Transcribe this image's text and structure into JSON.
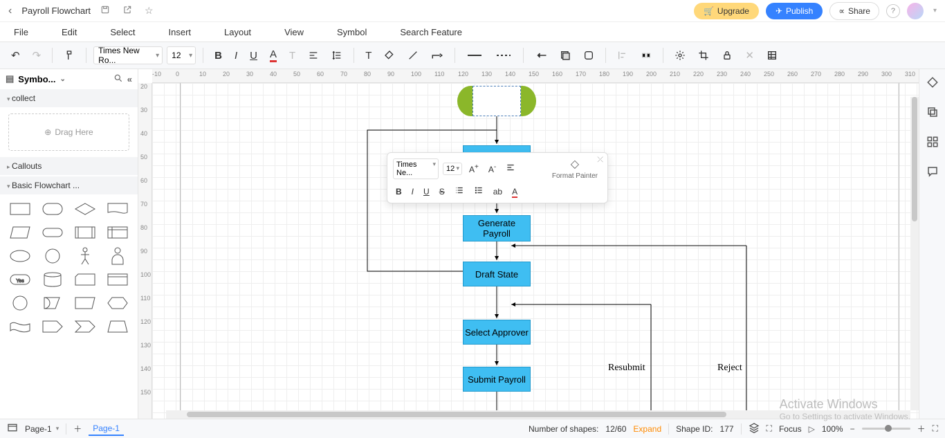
{
  "title_bar": {
    "doc_title": "Payroll Flowchart",
    "upgrade": "Upgrade",
    "publish": "Publish",
    "share": "Share"
  },
  "menu": {
    "file": "File",
    "edit": "Edit",
    "select": "Select",
    "insert": "Insert",
    "layout": "Layout",
    "view": "View",
    "symbol": "Symbol",
    "search": "Search Feature"
  },
  "toolbar": {
    "font": "Times New Ro...",
    "size": "12"
  },
  "left_panel": {
    "title": "Symbo...",
    "cat_collect": "collect",
    "drag_here": "Drag Here",
    "cat_callouts": "Callouts",
    "cat_basic": "Basic Flowchart ..."
  },
  "ctx_toolbar": {
    "font": "Times Ne...",
    "size": "12",
    "format_painter": "Format Painter"
  },
  "flowchart": {
    "generate_payroll": "Generate\nPayroll",
    "draft_state": "Draft State",
    "select_approver": "Select Approver",
    "submit_payroll": "Submit Payroll",
    "resubmit": "Resubmit",
    "reject": "Reject"
  },
  "ruler_h": [
    "-10",
    "0",
    "10",
    "20",
    "30",
    "40",
    "50",
    "60",
    "70",
    "80",
    "90",
    "100",
    "110",
    "120",
    "130",
    "140",
    "150",
    "160",
    "170",
    "180",
    "190",
    "200",
    "210",
    "220",
    "230",
    "240",
    "250",
    "260",
    "270",
    "280",
    "290",
    "300",
    "310"
  ],
  "ruler_v": [
    "20",
    "30",
    "40",
    "50",
    "60",
    "70",
    "80",
    "90",
    "100",
    "110",
    "120",
    "130",
    "140",
    "150"
  ],
  "status": {
    "page_sel": "Page-1",
    "page_tab": "Page-1",
    "shapes_label": "Number of shapes:",
    "shapes_val": "12/60",
    "expand": "Expand",
    "shape_id_label": "Shape ID:",
    "shape_id_val": "177",
    "focus": "Focus",
    "zoom": "100%"
  },
  "watermark": {
    "title": "Activate Windows",
    "sub": "Go to Settings to activate Windows."
  }
}
